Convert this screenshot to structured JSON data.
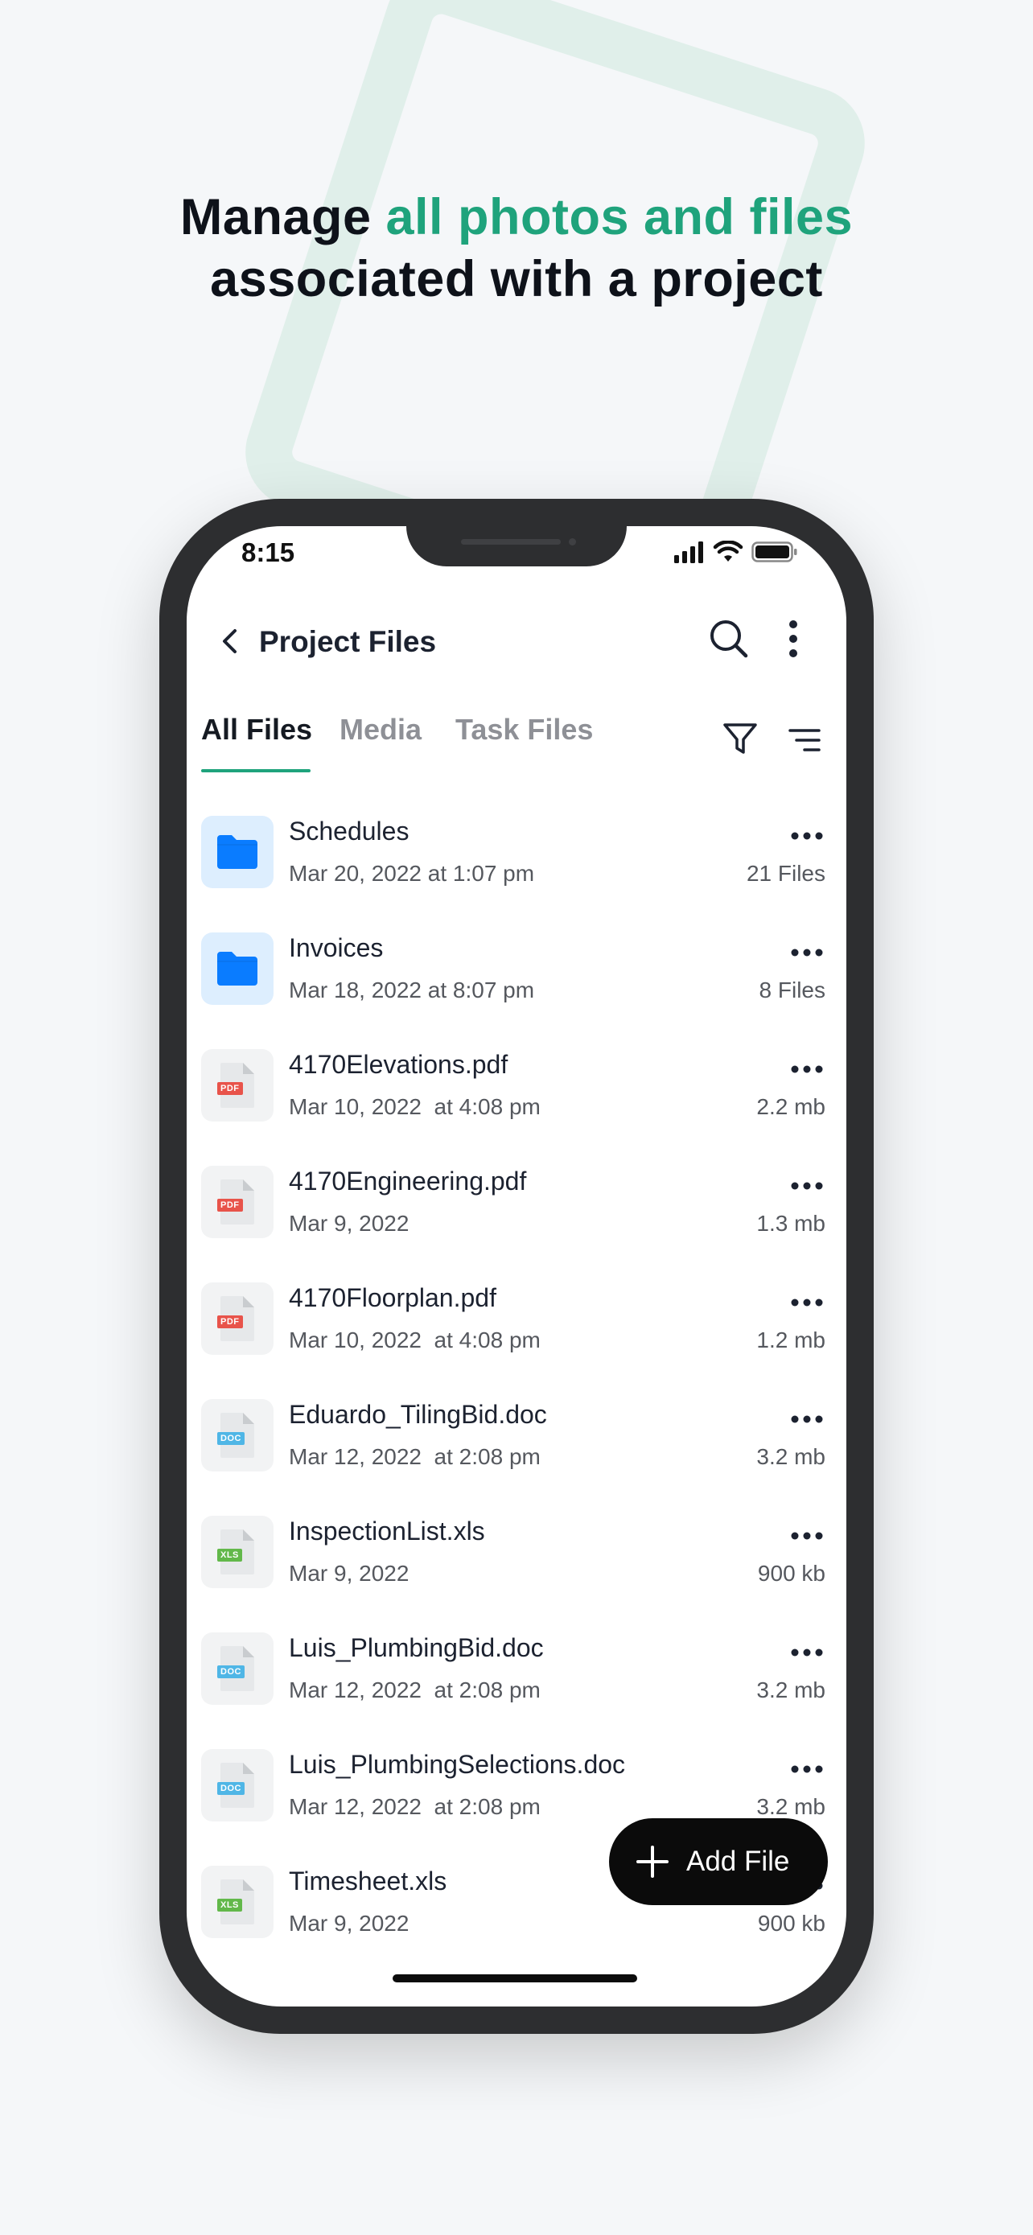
{
  "headline": {
    "line1_prefix": "Manage ",
    "line1_accent": "all photos and files",
    "line2": "associated with a project"
  },
  "colors": {
    "accent": "#1fa37c",
    "folder_blue": "#0a7cff",
    "pdf_red": "#e8534a",
    "doc_blue": "#4fb6e6",
    "xls_green": "#62b84a"
  },
  "status_bar": {
    "time": "8:15"
  },
  "appbar": {
    "title": "Project Files",
    "back_icon": "chevron-left-icon",
    "search_icon": "search-icon",
    "more_icon": "vertical-dots-icon"
  },
  "tabs": [
    {
      "label": "All Files",
      "active": true
    },
    {
      "label": "Media",
      "active": false
    },
    {
      "label": "Task Files",
      "active": false
    }
  ],
  "files": [
    {
      "name": "Schedules",
      "date": "Mar 20, 2022 at 1:07 pm",
      "size": "21 Files",
      "type": "folder"
    },
    {
      "name": "Invoices",
      "date": "Mar 18, 2022 at 8:07 pm",
      "size": "8 Files",
      "type": "folder"
    },
    {
      "name": "4170Elevations.pdf",
      "date": "Mar 10, 2022  at 4:08 pm",
      "size": "2.2 mb",
      "type": "PDF"
    },
    {
      "name": "4170Engineering.pdf",
      "date": "Mar 9, 2022",
      "size": "1.3 mb",
      "type": "PDF"
    },
    {
      "name": "4170Floorplan.pdf",
      "date": "Mar 10, 2022  at 4:08 pm",
      "size": "1.2 mb",
      "type": "PDF"
    },
    {
      "name": "Eduardo_TilingBid.doc",
      "date": "Mar 12, 2022  at 2:08 pm",
      "size": "3.2 mb",
      "type": "DOC"
    },
    {
      "name": "InspectionList.xls",
      "date": "Mar 9, 2022",
      "size": "900 kb",
      "type": "XLS"
    },
    {
      "name": "Luis_PlumbingBid.doc",
      "date": "Mar 12, 2022  at 2:08 pm",
      "size": "3.2 mb",
      "type": "DOC"
    },
    {
      "name": "Luis_PlumbingSelections.doc",
      "date": "Mar 12, 2022  at 2:08 pm",
      "size": "3.2 mb",
      "type": "DOC"
    },
    {
      "name": "Timesheet.xls",
      "date": "Mar 9, 2022",
      "size": "900 kb",
      "type": "XLS"
    }
  ],
  "fab": {
    "label": "Add File",
    "icon": "plus-icon"
  }
}
